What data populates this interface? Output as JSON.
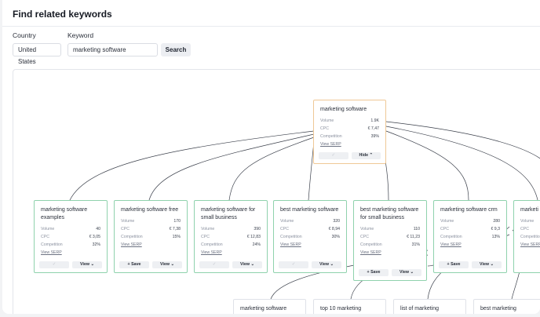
{
  "page": {
    "title": "Find related keywords"
  },
  "form": {
    "country_label": "Country",
    "keyword_label": "Keyword",
    "country_value": "United States",
    "keyword_value": "marketing software",
    "search_label": "Search"
  },
  "metric_labels": {
    "volume": "Volume",
    "cpc": "CPC",
    "competition": "Competition",
    "view_serp": "View SERP"
  },
  "icons": {
    "check": "✓",
    "chevron_down": "⌄",
    "chevron_up": "⌃",
    "plus": "+"
  },
  "root": {
    "keyword": "marketing software",
    "volume": "1.9K",
    "cpc": "€ 7,47",
    "competition": "39%",
    "button": "Hide",
    "button_icon": "chevron-up"
  },
  "children": [
    {
      "keyword": "marketing software examples",
      "volume": "40",
      "cpc": "€ 3,05",
      "competition": "32%",
      "saved": true,
      "view_label": "View"
    },
    {
      "keyword": "marketing software free",
      "volume": "170",
      "cpc": "€ 7,38",
      "competition": "15%",
      "saved": false,
      "save_label": "Save",
      "view_label": "View"
    },
    {
      "keyword": "marketing software for small business",
      "volume": "390",
      "cpc": "€ 12,83",
      "competition": "24%",
      "saved": true,
      "view_label": "View"
    },
    {
      "keyword": "best marketing software",
      "volume": "320",
      "cpc": "€ 8,94",
      "competition": "30%",
      "saved": true,
      "view_label": "View"
    },
    {
      "keyword": "best marketing software for small business",
      "volume": "110",
      "cpc": "€ 11,23",
      "competition": "31%",
      "saved": false,
      "save_label": "Save",
      "view_label": "View"
    },
    {
      "keyword": "marketing software crm",
      "volume": "280",
      "cpc": "€ 9,3",
      "competition": "13%",
      "saved": false,
      "save_label": "Save",
      "view_label": "View"
    },
    {
      "keyword": "marketi compan",
      "volume": "",
      "cpc": "",
      "competition": "",
      "saved": false,
      "view_label": ""
    }
  ],
  "grandchildren": [
    {
      "keyword": "marketing software"
    },
    {
      "keyword": "top 10 marketing"
    },
    {
      "keyword": "list of marketing"
    },
    {
      "keyword": "best marketing"
    }
  ],
  "colors": {
    "root_border": "#efc896",
    "child_border": "#8fd2ad",
    "edge": "#3a3f4a"
  }
}
